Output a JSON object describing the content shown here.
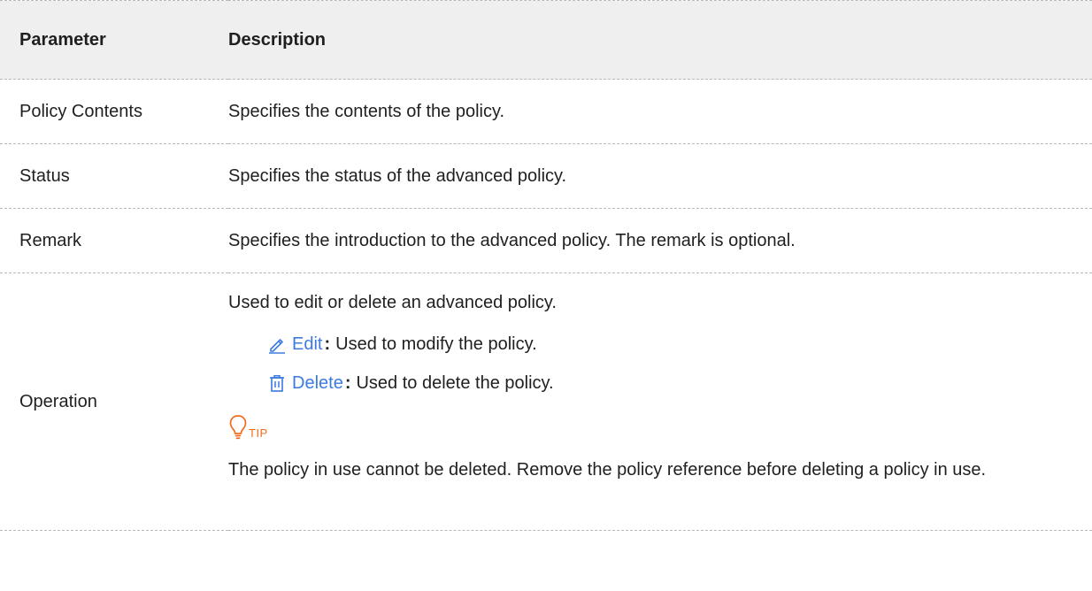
{
  "table": {
    "headers": {
      "parameter": "Parameter",
      "description": "Description"
    },
    "rows": [
      {
        "parameter": "Policy Contents",
        "description": "Specifies the contents of the policy."
      },
      {
        "parameter": "Status",
        "description": "Specifies the status of the advanced policy."
      },
      {
        "parameter": "Remark",
        "description": "Specifies the introduction to the advanced policy. The remark is optional."
      }
    ],
    "operation": {
      "parameter": "Operation",
      "intro": "Used to edit or delete an advanced policy.",
      "items": [
        {
          "icon": "edit-icon",
          "label": "Edit",
          "colon": ":",
          "text": "Used to modify the policy."
        },
        {
          "icon": "delete-icon",
          "label": "Delete",
          "colon": ":",
          "text": "Used to delete the policy."
        }
      ],
      "tip": {
        "icon": "lightbulb-icon",
        "label": "TIP",
        "text": "The policy in use cannot be deleted. Remove the policy reference before deleting a policy in use."
      }
    }
  },
  "colors": {
    "header_background": "#efefef",
    "link_blue": "#3b7ae0",
    "tip_orange": "#f26b1d",
    "divider": "#b8b8b8"
  }
}
